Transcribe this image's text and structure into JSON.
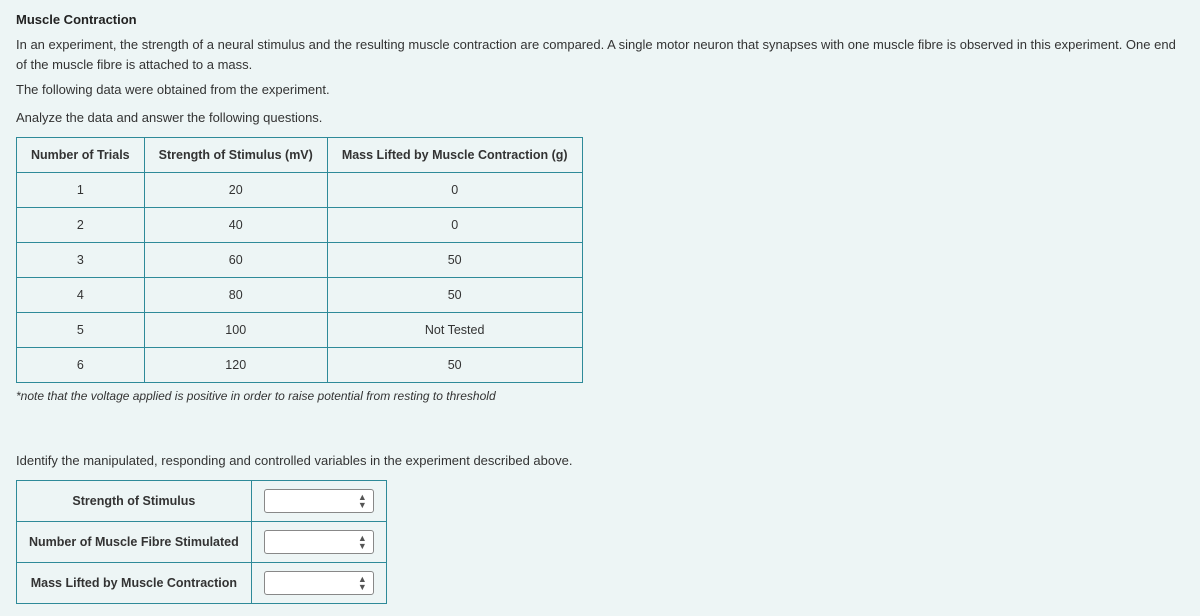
{
  "heading": "Muscle Contraction",
  "intro_line1": "In an experiment, the strength of a neural stimulus and the resulting muscle contraction are compared. A single motor neuron that synapses with one muscle fibre is observed in this experiment. One end of the muscle fibre is attached to a mass.",
  "intro_line2": "The following data were obtained from the experiment.",
  "instruction": "Analyze the data and answer the following questions.",
  "table_headers": {
    "col1": "Number of Trials",
    "col2": "Strength of Stimulus (mV)",
    "col3": "Mass Lifted by Muscle Contraction (g)"
  },
  "table_rows": [
    {
      "trial": "1",
      "stimulus": "20",
      "mass": "0"
    },
    {
      "trial": "2",
      "stimulus": "40",
      "mass": "0"
    },
    {
      "trial": "3",
      "stimulus": "60",
      "mass": "50"
    },
    {
      "trial": "4",
      "stimulus": "80",
      "mass": "50"
    },
    {
      "trial": "5",
      "stimulus": "100",
      "mass": "Not Tested"
    },
    {
      "trial": "6",
      "stimulus": "120",
      "mass": "50"
    }
  ],
  "footnote": "*note that the voltage applied is positive in order to raise potential from resting to threshold",
  "question": "Identify the manipulated, responding and controlled variables in the experiment described above.",
  "answer_rows": [
    {
      "label": "Strength of Stimulus"
    },
    {
      "label": "Number of Muscle Fibre Stimulated"
    },
    {
      "label": "Mass Lifted by Muscle Contraction"
    }
  ]
}
